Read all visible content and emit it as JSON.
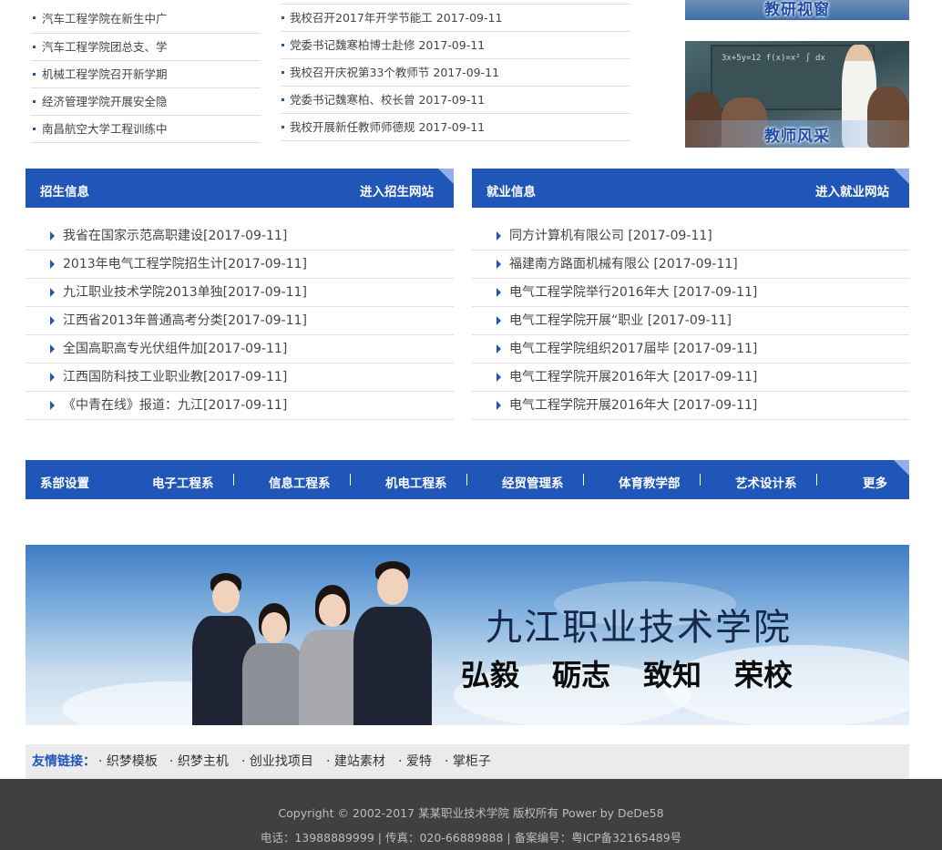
{
  "top_left_news": [
    "汽车工程学院在新生中广",
    "汽车工程学院团总支、学",
    "机械工程学院召开新学期",
    "经济管理学院开展安全隐",
    "南昌航空大学工程训练中"
  ],
  "top_mid_news": [
    "我校召开2017年开学节能工 2017-09-11",
    "党委书记魏寒柏博士赴修 2017-09-11",
    "我校召开庆祝第33个教师节 2017-09-11",
    "党委书记魏寒柏、校长曾 2017-09-11",
    "我校开展新任教师师德规 2017-09-11"
  ],
  "photos": {
    "research_caption": "教研视窗",
    "teacher_caption": "教师风采",
    "chalkboard_text": "3x+5y=12  f(x)=x²  ∫ dx"
  },
  "admissions": {
    "title": "招生信息",
    "more": "进入招生网站",
    "items": [
      "我省在国家示范高职建设[2017-09-11]",
      "2013年电气工程学院招生计[2017-09-11]",
      "九江职业技术学院2013单独[2017-09-11]",
      "江西省2013年普通高考分类[2017-09-11]",
      "全国高职高专光伏组件加[2017-09-11]",
      "江西国防科技工业职业教[2017-09-11]",
      "《中青在线》报道：九江[2017-09-11]"
    ]
  },
  "employment": {
    "title": "就业信息",
    "more": "进入就业网站",
    "items": [
      "同方计算机有限公司 [2017-09-11]",
      "福建南方路面机械有限公 [2017-09-11]",
      "电气工程学院举行2016年大 [2017-09-11]",
      "电气工程学院开展“职业 [2017-09-11]",
      "电气工程学院组织2017届毕 [2017-09-11]",
      "电气工程学院开展2016年大 [2017-09-11]",
      "电气工程学院开展2016年大 [2017-09-11]"
    ]
  },
  "departments": {
    "title": "系部设置",
    "items": [
      "电子工程系",
      "信息工程系",
      "机电工程系",
      "经贸管理系",
      "体育教学部",
      "艺术设计系"
    ],
    "more": "更多"
  },
  "banner": {
    "school_name": "九江职业技术学院",
    "motto": [
      "弘毅",
      "砺志",
      "致知",
      "荣校"
    ]
  },
  "friend_links": {
    "label": "友情链接：",
    "items": [
      "· 织梦模板",
      "· 织梦主机",
      "· 创业找项目",
      "· 建站素材",
      "· 爱特",
      "· 掌柜子"
    ]
  },
  "footer": {
    "copyright": "Copyright © 2002-2017 某某职业技术学院 版权所有 Power by DeDe58",
    "contact": "电话：13988889999 | 传真：020-66889888 | 备案编号：粤ICP备32165489号"
  },
  "colors": {
    "brand_blue": "#1f56b8",
    "footer_bg": "#404040",
    "links_bg": "#ebebeb"
  }
}
